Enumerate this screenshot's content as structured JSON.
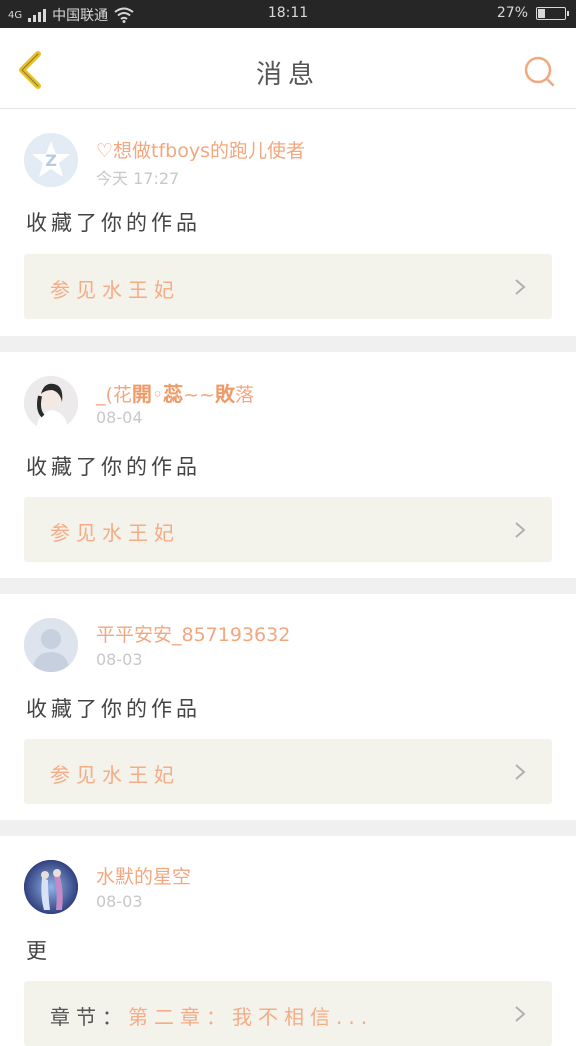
{
  "status_bar": {
    "carrier": "中国联通",
    "network": "4G",
    "time": "18:11",
    "battery_text": "27%",
    "battery_level": 0.27
  },
  "header": {
    "title": "消息",
    "back_icon": "chevron-left-icon",
    "search_icon": "search-icon"
  },
  "messages": [
    {
      "username": "♡想做tfboys的跑儿使者",
      "time": "今天 17:27",
      "action": "收藏了你的作品",
      "work_title": "参见水王妃"
    },
    {
      "username_pre": "_(花",
      "username_b1": "開",
      "username_mid": "◦",
      "username_b2": "蕊",
      "username_mid2": "~~",
      "username_b3": "敗",
      "username_post": "落",
      "time": "08-04",
      "action": "收藏了你的作品",
      "work_title": "参见水王妃"
    },
    {
      "username": "平平安安_857193632",
      "time": "08-03",
      "action": "收藏了你的作品",
      "work_title": "参见水王妃"
    },
    {
      "username": "水默的星空",
      "time": "08-03",
      "action": "更",
      "work_label": "章节：",
      "work_title": "第二章：我不相信..."
    }
  ],
  "colors": {
    "accent": "#f3a77e",
    "back_icon": "#e8c12a",
    "card_bg": "#f3f3ec",
    "separator": "#f0f0f0"
  }
}
